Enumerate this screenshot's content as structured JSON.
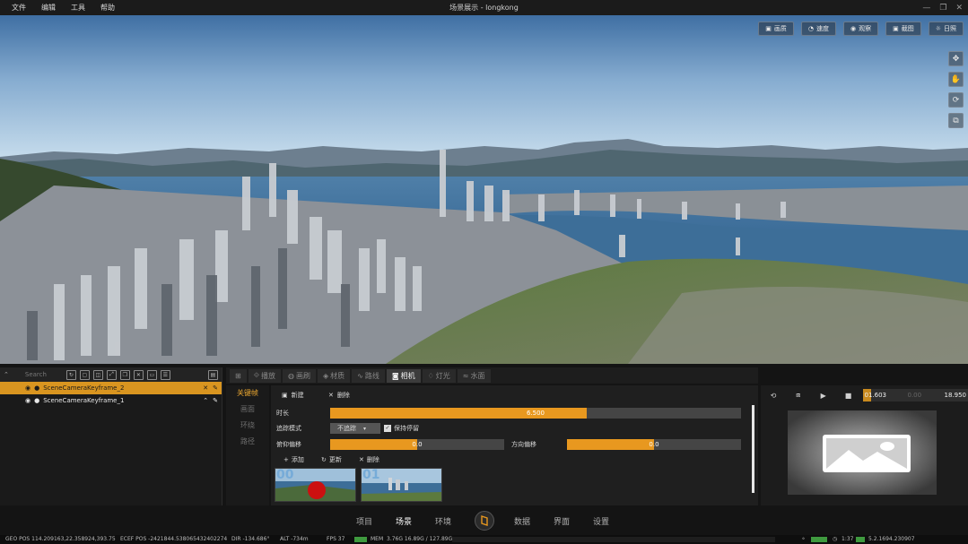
{
  "menu": [
    "文件",
    "编辑",
    "工具",
    "帮助"
  ],
  "window_title": "场景展示 - longkong",
  "viewport_tools": [
    {
      "icon": "image-icon",
      "label": "画质"
    },
    {
      "icon": "speed-icon",
      "label": "速度"
    },
    {
      "icon": "eye-icon",
      "label": "观察"
    },
    {
      "icon": "image-icon",
      "label": "截图"
    },
    {
      "icon": "sun-icon",
      "label": "日照"
    }
  ],
  "viewport_side_icons": [
    "move-icon",
    "hand-icon",
    "rotate-icon",
    "snapshot-icon"
  ],
  "outliner": {
    "search_placeholder": "Search",
    "items": [
      {
        "label": "SceneCameraKeyframe_2",
        "selected": true
      },
      {
        "label": "SceneCameraKeyframe_1",
        "selected": false
      }
    ]
  },
  "tabs": [
    {
      "icon": "grid-icon",
      "label": ""
    },
    {
      "icon": "paint-icon",
      "label": "播放"
    },
    {
      "icon": "brush-icon",
      "label": "画刷"
    },
    {
      "icon": "material-icon",
      "label": "材质"
    },
    {
      "icon": "route-icon",
      "label": "路线"
    },
    {
      "icon": "camera-icon",
      "label": "相机"
    },
    {
      "icon": "light-icon",
      "label": "灯光"
    },
    {
      "icon": "water-icon",
      "label": "水面"
    }
  ],
  "active_tab": "相机",
  "subnav": [
    "关键帧",
    "画面",
    "环绕",
    "路径"
  ],
  "camera": {
    "new_label": "新建",
    "delete_label": "删除",
    "duration_label": "时长",
    "duration_value": "6.500",
    "duration_fraction": 0.625,
    "tracking_label": "追踪模式",
    "tracking_value": "不追踪",
    "keep_label": "保持停留",
    "pitch_label": "俯仰偏移",
    "pitch_value": "0.0",
    "pitch_fraction": 0.5,
    "heading_label": "方向偏移",
    "heading_value": "0.0",
    "heading_fraction": 0.5,
    "add_label": "添加",
    "update_label": "更新",
    "remove_label": "删除",
    "thumbnails": [
      "00",
      "01"
    ]
  },
  "preview": {
    "time_current": "01.603",
    "time_mid": "0.00",
    "time_total": "18.950",
    "progress": 0.085
  },
  "bottom_nav": [
    "项目",
    "场景",
    "环境",
    "数据",
    "界面",
    "设置"
  ],
  "bottom_nav_active": "场景",
  "status": {
    "geo_pos": "GEO POS   114.209163,22.358924,393.75",
    "ecef_pos": "ECEF POS   -2421844.538065432402274",
    "dir": "DIR   -134.686°",
    "alt": "ALT   -734m",
    "fps": "FPS   37",
    "mem_label": "MEM",
    "mem_value": "3.76G   16.89G / 127.89G",
    "time": "1:37",
    "version": "5.2.1694.230907"
  },
  "colors": {
    "accent": "#e8981f",
    "selected_row": "#d99520",
    "panel": "#1f1f1f"
  }
}
